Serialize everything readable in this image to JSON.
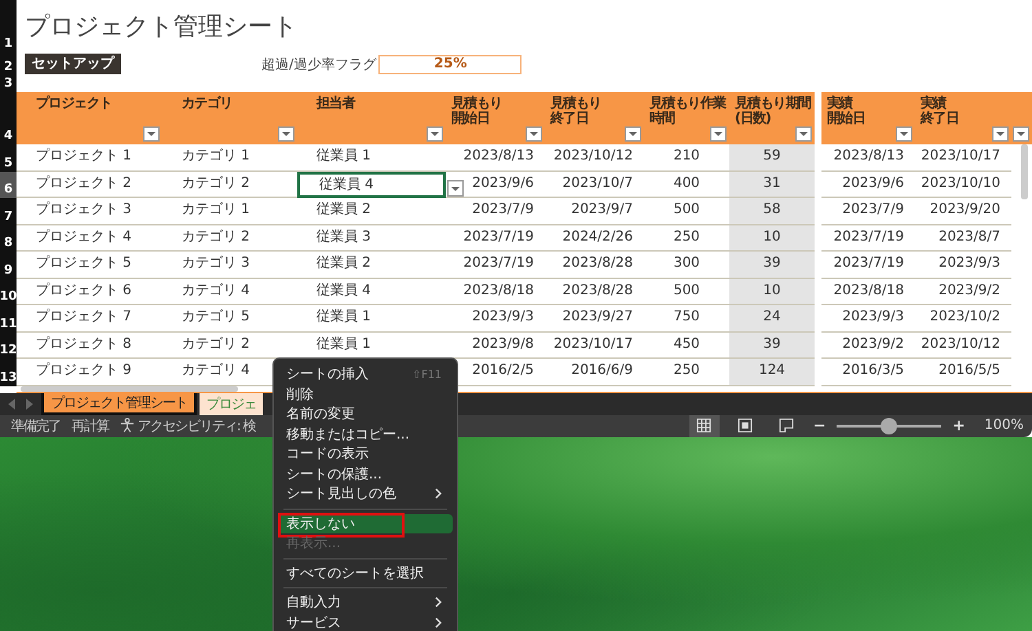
{
  "title": {
    "row_number": "1",
    "text": "プロジェクト管理シート"
  },
  "setup_row": {
    "row_number": "2",
    "button": "セットアップ",
    "flag_label": "超過/過少率フラグ",
    "flag_value": "25%"
  },
  "spacer_row": {
    "row_number": "3"
  },
  "table": {
    "header_row_number": "4",
    "columns": [
      {
        "label_lines": [
          "プロジェクト"
        ],
        "kind": "text"
      },
      {
        "label_lines": [
          "カテゴリ"
        ],
        "kind": "text"
      },
      {
        "label_lines": [
          "担当者"
        ],
        "kind": "text"
      },
      {
        "label_lines": [
          "見積もり",
          "開始日"
        ],
        "kind": "date"
      },
      {
        "label_lines": [
          "見積もり",
          "終了日"
        ],
        "kind": "date"
      },
      {
        "label_lines": [
          "見積もり作業時間"
        ],
        "kind": "number"
      },
      {
        "label_lines": [
          "見積もり期間",
          "(日数)"
        ],
        "kind": "computed"
      },
      {
        "label_lines": [
          "実績",
          "開始日"
        ],
        "kind": "date"
      },
      {
        "label_lines": [
          "実績",
          "終了日"
        ],
        "kind": "date"
      }
    ],
    "rows": [
      {
        "row_number": "5",
        "selected": false,
        "cells": [
          {
            "text": "プロジェクト 1",
            "selected": false
          },
          {
            "text": "カテゴリ 1",
            "selected": false
          },
          {
            "text": "従業員 1",
            "selected": false
          },
          {
            "text": "2023/8/13",
            "selected": false
          },
          {
            "text": "2023/10/12",
            "selected": false
          },
          {
            "text": "210",
            "selected": false
          },
          {
            "text": "59",
            "selected": false
          },
          {
            "text": "2023/8/13",
            "selected": false
          },
          {
            "text": "2023/10/17",
            "selected": false
          }
        ]
      },
      {
        "row_number": "6",
        "selected": true,
        "cells": [
          {
            "text": "プロジェクト 2",
            "selected": false
          },
          {
            "text": "カテゴリ 2",
            "selected": false
          },
          {
            "text": "従業員 4",
            "selected": true
          },
          {
            "text": "2023/9/6",
            "selected": false
          },
          {
            "text": "2023/10/7",
            "selected": false
          },
          {
            "text": "400",
            "selected": false
          },
          {
            "text": "31",
            "selected": false
          },
          {
            "text": "2023/9/6",
            "selected": false
          },
          {
            "text": "2023/10/10",
            "selected": false
          }
        ]
      },
      {
        "row_number": "7",
        "selected": false,
        "cells": [
          {
            "text": "プロジェクト 3",
            "selected": false
          },
          {
            "text": "カテゴリ 1",
            "selected": false
          },
          {
            "text": "従業員 2",
            "selected": false
          },
          {
            "text": "2023/7/9",
            "selected": false
          },
          {
            "text": "2023/9/7",
            "selected": false
          },
          {
            "text": "500",
            "selected": false
          },
          {
            "text": "58",
            "selected": false
          },
          {
            "text": "2023/7/9",
            "selected": false
          },
          {
            "text": "2023/9/20",
            "selected": false
          }
        ]
      },
      {
        "row_number": "8",
        "selected": false,
        "cells": [
          {
            "text": "プロジェクト 4",
            "selected": false
          },
          {
            "text": "カテゴリ 2",
            "selected": false
          },
          {
            "text": "従業員 3",
            "selected": false
          },
          {
            "text": "2023/7/19",
            "selected": false
          },
          {
            "text": "2024/2/26",
            "selected": false
          },
          {
            "text": "250",
            "selected": false
          },
          {
            "text": "10",
            "selected": false
          },
          {
            "text": "2023/7/19",
            "selected": false
          },
          {
            "text": "2023/8/7",
            "selected": false
          }
        ]
      },
      {
        "row_number": "9",
        "selected": false,
        "cells": [
          {
            "text": "プロジェクト 5",
            "selected": false
          },
          {
            "text": "カテゴリ 3",
            "selected": false
          },
          {
            "text": "従業員 2",
            "selected": false
          },
          {
            "text": "2023/7/19",
            "selected": false
          },
          {
            "text": "2023/8/28",
            "selected": false
          },
          {
            "text": "300",
            "selected": false
          },
          {
            "text": "39",
            "selected": false
          },
          {
            "text": "2023/7/19",
            "selected": false
          },
          {
            "text": "2023/9/3",
            "selected": false
          }
        ]
      },
      {
        "row_number": "10",
        "selected": false,
        "cells": [
          {
            "text": "プロジェクト 6",
            "selected": false
          },
          {
            "text": "カテゴリ 4",
            "selected": false
          },
          {
            "text": "従業員 4",
            "selected": false
          },
          {
            "text": "2023/8/18",
            "selected": false
          },
          {
            "text": "2023/8/28",
            "selected": false
          },
          {
            "text": "500",
            "selected": false
          },
          {
            "text": "10",
            "selected": false
          },
          {
            "text": "2023/8/18",
            "selected": false
          },
          {
            "text": "2023/9/2",
            "selected": false
          }
        ]
      },
      {
        "row_number": "11",
        "selected": false,
        "cells": [
          {
            "text": "プロジェクト 7",
            "selected": false
          },
          {
            "text": "カテゴリ 5",
            "selected": false
          },
          {
            "text": "従業員 1",
            "selected": false
          },
          {
            "text": "2023/9/3",
            "selected": false
          },
          {
            "text": "2023/9/27",
            "selected": false
          },
          {
            "text": "750",
            "selected": false
          },
          {
            "text": "24",
            "selected": false
          },
          {
            "text": "2023/9/3",
            "selected": false
          },
          {
            "text": "2023/10/2",
            "selected": false
          }
        ]
      },
      {
        "row_number": "12",
        "selected": false,
        "cells": [
          {
            "text": "プロジェクト 8",
            "selected": false
          },
          {
            "text": "カテゴリ 2",
            "selected": false
          },
          {
            "text": "従業員 1",
            "selected": false
          },
          {
            "text": "2023/9/8",
            "selected": false
          },
          {
            "text": "2023/10/17",
            "selected": false
          },
          {
            "text": "450",
            "selected": false
          },
          {
            "text": "39",
            "selected": false
          },
          {
            "text": "2023/9/2",
            "selected": false
          },
          {
            "text": "2023/10/12",
            "selected": false
          }
        ]
      },
      {
        "row_number": "13",
        "selected": false,
        "cells": [
          {
            "text": "プロジェクト 9",
            "selected": false
          },
          {
            "text": "カテゴリ 4",
            "selected": false
          },
          null,
          {
            "text": "2016/2/5",
            "selected": false
          },
          {
            "text": "2016/6/9",
            "selected": false
          },
          {
            "text": "250",
            "selected": false
          },
          {
            "text": "124",
            "selected": false
          },
          {
            "text": "2016/3/5",
            "selected": false
          },
          {
            "text": "2016/5/5",
            "selected": false
          }
        ]
      }
    ]
  },
  "sheet_tabs": [
    {
      "label": "プロジェクト管理シート",
      "selected": true
    },
    {
      "label": "プロジェ",
      "selected": false
    }
  ],
  "status_bar": {
    "ready": "準備完了",
    "recalc": "再計算",
    "accessibility": "アクセシビリティ: 検",
    "view_buttons": [
      {
        "kind": "normal",
        "selected": true
      },
      {
        "kind": "page_layout",
        "selected": false
      },
      {
        "kind": "page_break",
        "selected": false
      }
    ],
    "zoom": {
      "minus": "−",
      "plus": "+",
      "level": 0.5,
      "reading": "100%"
    }
  },
  "context_menu": [
    {
      "kind": "item",
      "label": "シートの挿入",
      "shortcut": "⇧F11",
      "submenu": false,
      "disabled": false,
      "selected": false,
      "annotated": false
    },
    {
      "kind": "item",
      "label": "削除",
      "submenu": false,
      "disabled": false,
      "selected": false,
      "annotated": false
    },
    {
      "kind": "item",
      "label": "名前の変更",
      "submenu": false,
      "disabled": false,
      "selected": false,
      "annotated": false
    },
    {
      "kind": "item",
      "label": "移動またはコピー...",
      "submenu": false,
      "disabled": false,
      "selected": false,
      "annotated": false
    },
    {
      "kind": "item",
      "label": "コードの表示",
      "submenu": false,
      "disabled": false,
      "selected": false,
      "annotated": false
    },
    {
      "kind": "item",
      "label": "シートの保護...",
      "submenu": false,
      "disabled": false,
      "selected": false,
      "annotated": false
    },
    {
      "kind": "item",
      "label": "シート見出しの色",
      "submenu": true,
      "disabled": false,
      "selected": false,
      "annotated": false
    },
    {
      "kind": "separator"
    },
    {
      "kind": "item",
      "label": "表示しない",
      "submenu": false,
      "disabled": false,
      "selected": true,
      "annotated": true
    },
    {
      "kind": "item",
      "label": "再表示...",
      "submenu": false,
      "disabled": true,
      "selected": false,
      "annotated": false
    },
    {
      "kind": "separator"
    },
    {
      "kind": "item",
      "label": "すべてのシートを選択",
      "submenu": false,
      "disabled": false,
      "selected": false,
      "annotated": false
    },
    {
      "kind": "separator"
    },
    {
      "kind": "item",
      "label": "自動入力",
      "submenu": true,
      "disabled": false,
      "selected": false,
      "annotated": false
    },
    {
      "kind": "item",
      "label": "サービス",
      "submenu": true,
      "disabled": false,
      "selected": false,
      "annotated": false
    }
  ]
}
